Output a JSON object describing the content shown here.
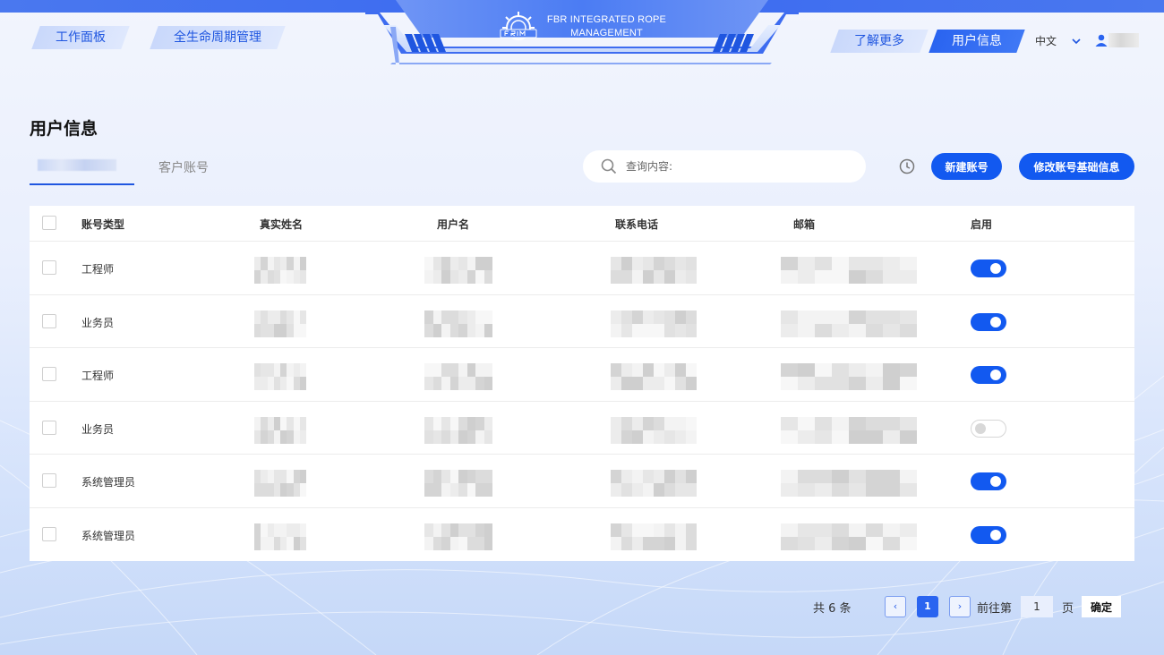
{
  "header": {
    "nav_left": [
      "工作面板",
      "全生命周期管理"
    ],
    "logo_line1": "FBR INTEGRATED ROPE",
    "logo_line2": "MANAGEMENT",
    "learn_more": "了解更多",
    "user_info": "用户信息",
    "language": "中文"
  },
  "page": {
    "title": "用户信息",
    "tabs": [
      {
        "label": "",
        "active": true
      },
      {
        "label": "客户账号",
        "active": false
      }
    ],
    "search_placeholder": "查询内容:",
    "new_account": "新建账号",
    "edit_account": "修改账号基础信息"
  },
  "table": {
    "columns": [
      "账号类型",
      "真实姓名",
      "用户名",
      "联系电话",
      "邮箱",
      "启用"
    ],
    "rows": [
      {
        "type": "工程师",
        "enabled": true
      },
      {
        "type": "业务员",
        "enabled": true
      },
      {
        "type": "工程师",
        "enabled": true
      },
      {
        "type": "业务员",
        "enabled": false
      },
      {
        "type": "系统管理员",
        "enabled": true
      },
      {
        "type": "系统管理员",
        "enabled": true
      }
    ]
  },
  "pagination": {
    "total": "共 6 条",
    "prev": "‹",
    "current_page": "1",
    "next": "›",
    "goto_prefix": "前往第",
    "goto_value": "1",
    "goto_suffix": "页",
    "confirm": "确定"
  },
  "colors": {
    "primary": "#1259f0",
    "accent": "#1f56e0",
    "toggle_off": "#d8d8d8"
  }
}
